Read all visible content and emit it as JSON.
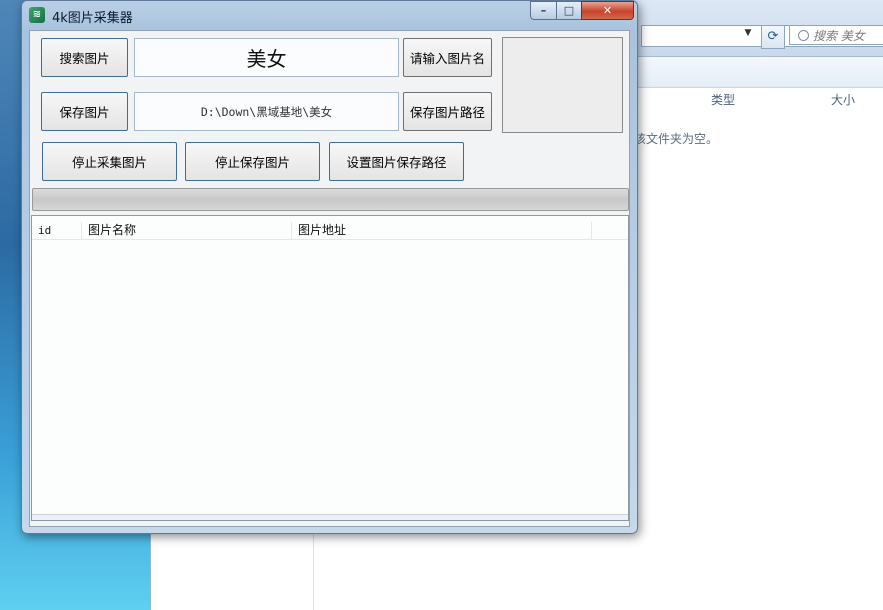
{
  "window": {
    "title": "4k图片采集器",
    "icon": "app-logo-icon",
    "controls": {
      "minimize": "–",
      "maximize": "□",
      "close": "✕"
    }
  },
  "controls": {
    "search_button": "搜索图片",
    "keyword_value": "美女",
    "keyword_hint_button": "请输入图片名",
    "save_button": "保存图片",
    "path_value": "D:\\Down\\黑域基地\\美女",
    "path_hint_button": "保存图片路径",
    "stop_collect_button": "停止采集图片",
    "stop_save_button": "停止保存图片",
    "set_path_button": "设置图片保存路径"
  },
  "progress": {
    "value": 0
  },
  "list": {
    "columns": [
      "id",
      "图片名称",
      "图片地址"
    ],
    "rows": []
  },
  "background_explorer": {
    "search_placeholder": "搜索 美女",
    "columns": [
      "类型",
      "大小"
    ],
    "empty_message": "该文件夹为空。"
  },
  "colors": {
    "button_border": "#3e6d97",
    "close_button": "#c7432a",
    "titlebar": "#b9cfe6"
  }
}
